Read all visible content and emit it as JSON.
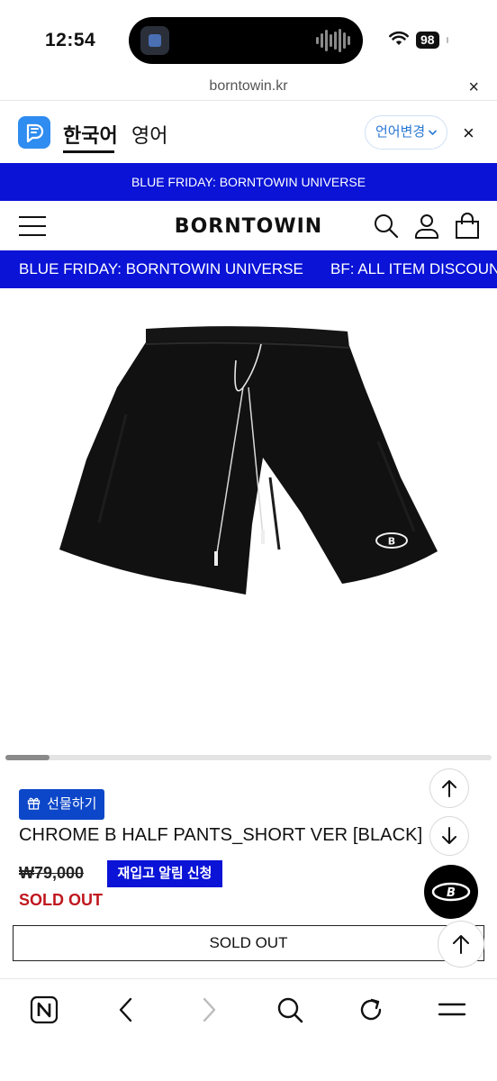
{
  "status_bar": {
    "time": "12:54",
    "battery": "98"
  },
  "browser": {
    "url": "borntowin.kr",
    "close_label": "×"
  },
  "translate_bar": {
    "current_language": "한국어",
    "other_language": "영어",
    "change_label": "언어변경",
    "close_label": "×"
  },
  "promo_banner": {
    "text": "BLUE FRIDAY: BORNTOWIN UNIVERSE"
  },
  "header": {
    "logo": "BORNTOWIN"
  },
  "marquee": {
    "items": [
      "BLUE FRIDAY: BORNTOWIN UNIVERSE",
      "BF: ALL ITEM DISCOUN"
    ]
  },
  "product": {
    "gift_label": "선물하기",
    "name": "CHROME B HALF PANTS_SHORT VER [BLACK]",
    "original_price": "₩79,000",
    "restock_label": "재입고 알림 신청",
    "status": "SOLD OUT",
    "buy_button_label": "SOLD OUT",
    "image_progress": 0.09
  },
  "colors": {
    "brand_blue": "#0a13d6",
    "gift_blue": "#0d47c9",
    "sold_out_red": "#c0171f"
  },
  "icons": {
    "header": [
      "menu-icon",
      "search-icon",
      "user-icon",
      "shopping-bag-icon"
    ],
    "floating": [
      "arrow-up-icon",
      "arrow-down-icon",
      "brand-b-icon",
      "scroll-top-icon"
    ],
    "toolbar": [
      "naver-home-icon",
      "back-icon",
      "forward-icon",
      "search-icon",
      "refresh-icon",
      "menu-icon"
    ]
  }
}
